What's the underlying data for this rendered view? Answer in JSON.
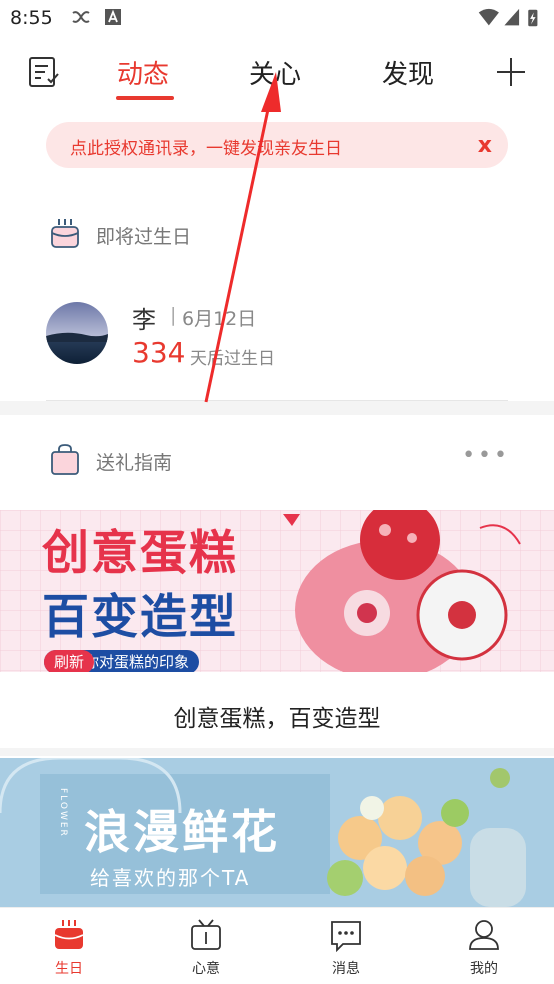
{
  "status_bar": {
    "time": "8:55"
  },
  "top_nav": {
    "tabs": [
      {
        "label": "动态",
        "active": true
      },
      {
        "label": "关心",
        "active": false
      },
      {
        "label": "发现",
        "active": false
      }
    ]
  },
  "auth_banner": {
    "text": "点此授权通讯录，一键发现亲友生日",
    "close": "x"
  },
  "upcoming": {
    "title": "即将过生日",
    "entries": [
      {
        "name": "李",
        "separator": "|",
        "date": "6月12日",
        "days": "334",
        "suffix": "天后过生日"
      }
    ]
  },
  "gift_guide": {
    "title": "送礼指南",
    "more": "•••",
    "cards": [
      {
        "caption": "创意蛋糕，百变造型",
        "banner_line1": "创意蛋糕",
        "banner_line2": "百变造型",
        "tag_left": "刷新",
        "tag_right": "你对蛋糕的印象"
      },
      {
        "banner_title": "浪漫鲜花",
        "banner_sub": "给喜欢的那个TA",
        "banner_vertical": "FLOWER"
      }
    ]
  },
  "bottom_nav": {
    "items": [
      {
        "label": "生日",
        "active": true
      },
      {
        "label": "心意",
        "active": false
      },
      {
        "label": "消息",
        "active": false
      },
      {
        "label": "我的",
        "active": false
      }
    ]
  },
  "colors": {
    "accent": "#e8392f",
    "banner_bg": "#fde6e6",
    "cake_red": "#e6334b",
    "cake_blue": "#1d4da3",
    "flower_bg": "#a9cde3"
  }
}
